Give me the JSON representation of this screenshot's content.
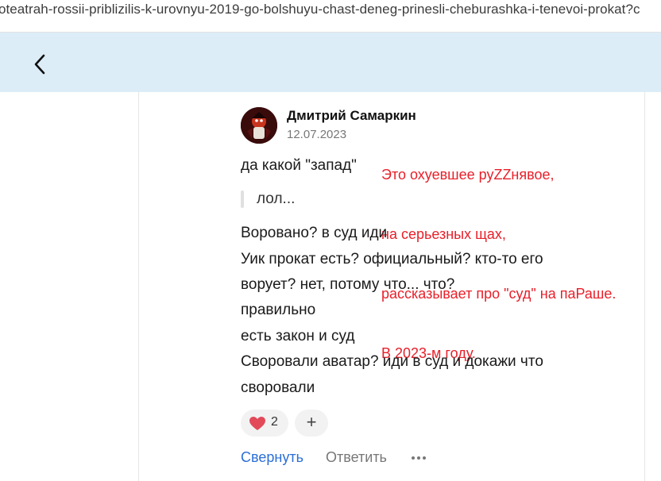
{
  "browser": {
    "url": "oteatrah-rossii-priblizilis-k-urovnyu-2019-go-bolshuyu-chast-deneg-prinesli-cheburashka-i-tenevoi-prokat?c"
  },
  "header": {
    "back_icon": "chevron-left-icon",
    "background_color": "#dcedf8"
  },
  "comment": {
    "author": "Дмитрий Самаркин",
    "date": "12.07.2023",
    "first_line": "да какой \"запад\"",
    "quote": "лол...",
    "lines": [
      "Воровано? в суд иди",
      "Уик прокат есть? официальный? кто-то его",
      "ворует? нет, потому что... что?",
      "правильно",
      "есть закон и суд",
      "Своровали аватар? иди в суд и докажи что",
      "своровали"
    ],
    "reaction": {
      "icon": "heart-icon",
      "count": "2",
      "add_icon": "plus-icon"
    },
    "actions": {
      "collapse": "Свернуть",
      "reply": "Ответить",
      "more_icon": "more-dots-icon"
    }
  },
  "annotation": {
    "color": "#e8202a",
    "lines": [
      "Это охуевшее руZZнявое,",
      "на серьезных щах,",
      "рассказывает про \"суд\" на паРаше.",
      "В 2023-м году."
    ]
  }
}
